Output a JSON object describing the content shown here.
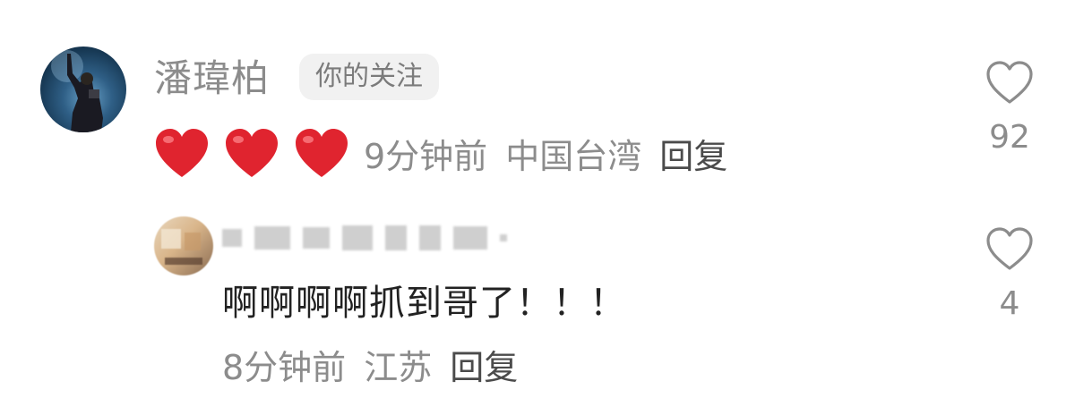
{
  "comment": {
    "username": "潘瑋柏",
    "follow_badge": "你的关注",
    "emoji": [
      "red-heart",
      "red-heart",
      "red-heart"
    ],
    "time": "9分钟前",
    "location": "中国台湾",
    "reply_label": "回复",
    "like_count": "92"
  },
  "reply": {
    "text": "啊啊啊啊抓到哥了！！！",
    "time": "8分钟前",
    "location": "江苏",
    "reply_label": "回复",
    "like_count": "4"
  },
  "colors": {
    "meta_gray": "#8c8c8c",
    "reply_dark": "#4b4b4b",
    "heart_red": "#e0242f",
    "badge_bg": "#f1f1f1"
  }
}
